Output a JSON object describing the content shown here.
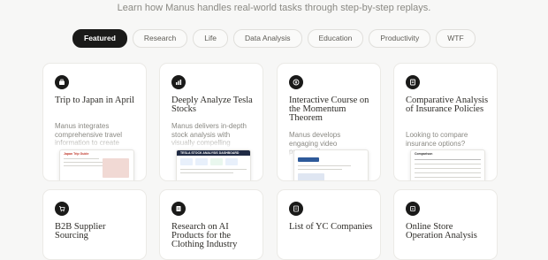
{
  "header": {
    "subtitle": "Learn how Manus handles real-world tasks through step-by-step replays."
  },
  "tabs": [
    {
      "label": "Featured",
      "active": true
    },
    {
      "label": "Research"
    },
    {
      "label": "Life"
    },
    {
      "label": "Data Analysis"
    },
    {
      "label": "Education"
    },
    {
      "label": "Productivity"
    },
    {
      "label": "WTF"
    }
  ],
  "cards": [
    {
      "title": "Trip to Japan in April",
      "desc": "Manus integrates comprehensive travel information to create",
      "icon": "suitcase-icon",
      "thumb_label": "Japan Trip Guide"
    },
    {
      "title": "Deeply Analyze Tesla Stocks",
      "desc": "Manus delivers in-depth stock analysis with visually compelling",
      "icon": "chart-icon",
      "thumb_label": "TESLA STOCK ANALYSIS DASHBOARD"
    },
    {
      "title": "Interactive Course on the Momentum Theorem",
      "desc": "Manus develops engaging video presentations",
      "icon": "compass-icon",
      "thumb_label": ""
    },
    {
      "title": "Comparative Analysis of Insurance Policies",
      "desc": "Looking to compare insurance options?",
      "icon": "document-icon",
      "thumb_label": "Comparison"
    },
    {
      "title": "B2B Supplier Sourcing",
      "desc": "",
      "icon": "cart-icon"
    },
    {
      "title": "Research on AI Products for the Clothing Industry",
      "desc": "",
      "icon": "book-icon"
    },
    {
      "title": "List of YC Companies",
      "desc": "",
      "icon": "list-icon"
    },
    {
      "title": "Online Store Operation Analysis",
      "desc": "",
      "icon": "store-icon"
    }
  ]
}
